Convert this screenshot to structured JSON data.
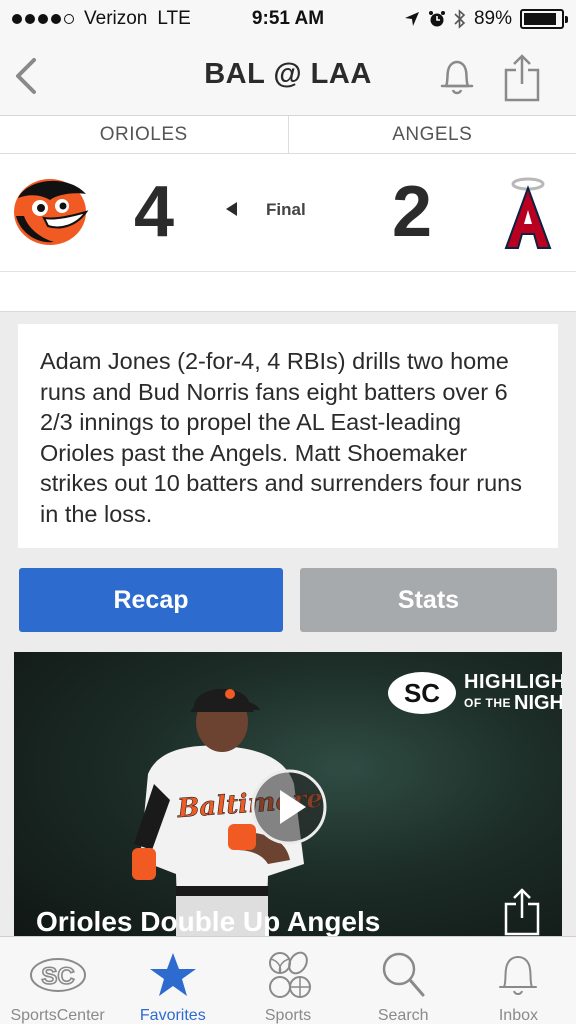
{
  "status_bar": {
    "carrier": "Verizon",
    "network": "LTE",
    "time": "9:51 AM",
    "battery": "89%",
    "battery_level": 0.89
  },
  "nav": {
    "title": "BAL @ LAA"
  },
  "scoreboard": {
    "away": {
      "name": "ORIOLES",
      "score": "4",
      "logo_icon": "orioles-logo-icon"
    },
    "home": {
      "name": "ANGELS",
      "score": "2",
      "logo_icon": "angels-logo-icon"
    },
    "status": "Final"
  },
  "summary": {
    "text": "Adam Jones (2-for-4, 4 RBIs) drills two home runs and Bud Norris fans eight batters over 6 2/3 innings to propel the AL East-leading Orioles past the Angels. Matt Shoemaker strikes out 10 batters and surrenders four runs in the loss."
  },
  "tabs": {
    "recap_label": "Recap",
    "stats_label": "Stats",
    "active": "recap"
  },
  "video": {
    "badge_top": "HIGHLIGHT",
    "badge_of_the": "OF THE",
    "badge_night": "NIGHT",
    "jersey_text": "Baltimore",
    "title": "Orioles Double Up Angels"
  },
  "tab_bar": {
    "items": [
      {
        "label": "SportsCenter",
        "icon": "sportscenter-icon"
      },
      {
        "label": "Favorites",
        "icon": "star-icon"
      },
      {
        "label": "Sports",
        "icon": "sports-balls-icon"
      },
      {
        "label": "Search",
        "icon": "search-icon"
      },
      {
        "label": "Inbox",
        "icon": "bell-icon"
      }
    ],
    "active_index": 1
  },
  "colors": {
    "accent": "#2e6bcf",
    "stats_tab": "#a7aaac",
    "orioles_orange": "#f15a22",
    "angels_red": "#ba0021"
  }
}
